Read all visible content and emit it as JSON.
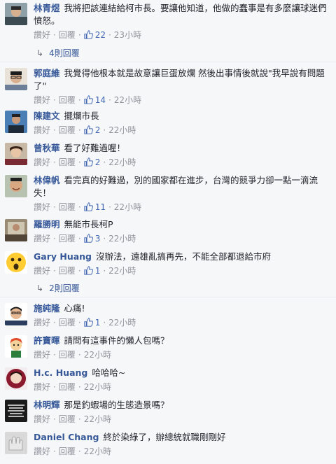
{
  "comments": [
    {
      "author": "林青煜",
      "text": "我將把該連結給柯市長。要讓他知道，他做的蠢事是有多麼讓球迷們憤怒。",
      "like_label": "讚好",
      "reply_label": "回覆",
      "likes": "22",
      "time": "23小時"
    },
    {
      "author": "郭庭維",
      "text": "我覺得他根本就是故意讓巨蛋放爛 然後出事情後就說\"我早說有問題了\"",
      "like_label": "讚好",
      "reply_label": "回覆",
      "likes": "14",
      "time": "22小時"
    },
    {
      "author": "陳建文",
      "text": "擺爛市長",
      "like_label": "讚好",
      "reply_label": "回覆",
      "likes": "2",
      "time": "22小時"
    },
    {
      "author": "曾秋華",
      "text": "看了好難過喔！",
      "like_label": "讚好",
      "reply_label": "回覆",
      "likes": "2",
      "time": "22小時"
    },
    {
      "author": "林偉帆",
      "text": "看完真的好難過，別的國家都在進步，台灣的競爭力卻一點一滴流失！",
      "like_label": "讚好",
      "reply_label": "回覆",
      "likes": "11",
      "time": "22小時"
    },
    {
      "author": "羅勝明",
      "text": "無能市長柯P",
      "like_label": "讚好",
      "reply_label": "回覆",
      "likes": "3",
      "time": "22小時"
    },
    {
      "author": "Gary Huang",
      "text": "沒辦法，遠雄亂搞再先，不能全部都退給市府",
      "like_label": "讚好",
      "reply_label": "回覆",
      "likes": "1",
      "time": "22小時"
    },
    {
      "author": "施純隆",
      "text": "心痛!",
      "like_label": "讚好",
      "reply_label": "回覆",
      "likes": "1",
      "time": "22小時"
    },
    {
      "author": "許寶暉",
      "text": "請問有這事件的懶人包嗎？",
      "like_label": "讚好",
      "reply_label": "回覆",
      "likes": "",
      "time": "22小時"
    },
    {
      "author": "H.c. Huang",
      "text": "哈哈哈~",
      "like_label": "讚好",
      "reply_label": "回覆",
      "likes": "",
      "time": "22小時"
    },
    {
      "author": "林明輝",
      "text": "那是釣蝦場的生態造景嗎？",
      "like_label": "讚好",
      "reply_label": "回覆",
      "likes": "",
      "time": "22小時"
    },
    {
      "author": "Daniel Chang",
      "text": "終於染綠了，辦總統就職剛剛好",
      "like_label": "讚好",
      "reply_label": "回覆",
      "likes": "",
      "time": "22小時"
    }
  ],
  "reply_threads": {
    "first": "4則回覆",
    "second": "2則回覆"
  },
  "avatar_text": "無言有時只能心痛到了無語然後我的腦袋多了點空白",
  "colors": {
    "author": "#365899",
    "likes": "#4267b2",
    "meta": "#90949c",
    "background": "#f6f7f9"
  }
}
